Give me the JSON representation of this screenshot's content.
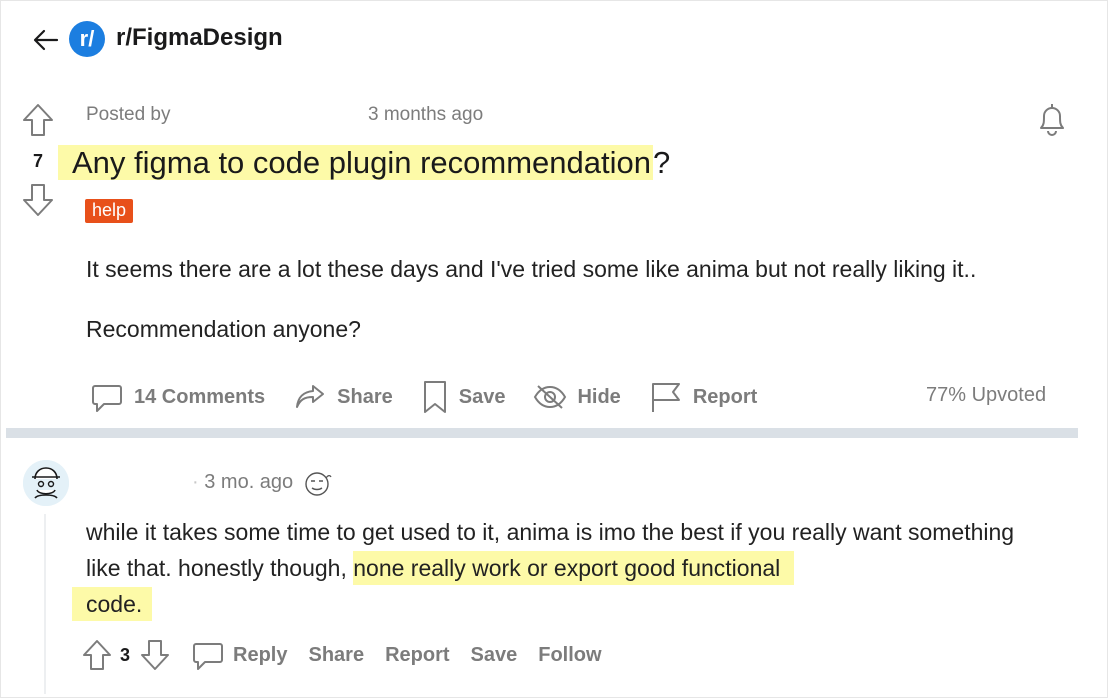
{
  "header": {
    "subreddit_icon_text": "r/",
    "subreddit_name": "r/FigmaDesign"
  },
  "post": {
    "posted_by_label": "Posted by",
    "time": "3 months ago",
    "score": "7",
    "title_highlighted": "Any figma to code plugin recommendation",
    "title_rest": "?",
    "flair": "help",
    "body_paragraphs": [
      "It seems there are a lot these days and I've tried some like anima but not really liking it..",
      "Recommendation anyone?"
    ],
    "actions": {
      "comments": "14 Comments",
      "share": "Share",
      "save": "Save",
      "hide": "Hide",
      "report": "Report"
    },
    "upvoted": "77% Upvoted"
  },
  "comment": {
    "time": "3 mo. ago",
    "text_plain": "while it takes some time to get used to it, anima is imo the best if you really want something like that. honestly though, ",
    "text_highlighted_1": "none really work or export good functional",
    "text_highlighted_2": "code.",
    "score": "3",
    "actions": {
      "reply": "Reply",
      "share": "Share",
      "report": "Report",
      "save": "Save",
      "follow": "Follow"
    }
  },
  "colors": {
    "brand": "#1c7ee0",
    "flair": "#e8501a",
    "highlight": "#fdfaa8",
    "divider": "#dae0e6"
  },
  "icons": [
    "back-arrow-icon",
    "upvote-icon",
    "downvote-icon",
    "bell-icon",
    "comment-icon",
    "share-icon",
    "bookmark-icon",
    "hide-icon",
    "flag-icon",
    "avatar",
    "emoji-icon"
  ]
}
